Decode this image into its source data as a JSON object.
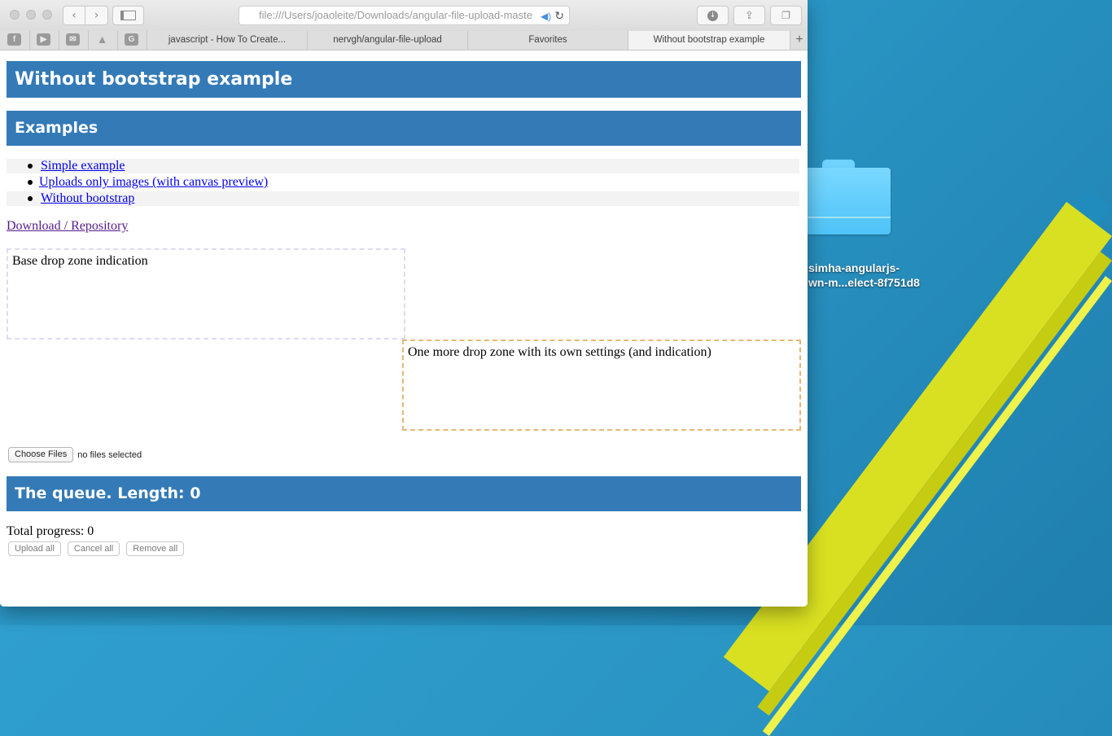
{
  "browser": {
    "address_url": "file:///Users/joaoleite/Downloads/angular-file-upload-maste",
    "favorites": [
      "facebook-icon",
      "youtube-icon",
      "gmail-icon",
      "drive-icon",
      "g-icon"
    ],
    "tabs": [
      {
        "label": "javascript - How To Create..."
      },
      {
        "label": "nervgh/angular-file-upload"
      },
      {
        "label": "Favorites"
      },
      {
        "label": "Without bootstrap example",
        "active": true
      }
    ],
    "new_tab_label": "+"
  },
  "page": {
    "title": "Without bootstrap example",
    "examples_heading": "Examples",
    "examples": [
      {
        "label": "Simple example"
      },
      {
        "label": "Uploads only images (with canvas preview)"
      },
      {
        "label": "Without bootstrap"
      }
    ],
    "download_link": "Download / Repository",
    "dropzone_base": "Base drop zone indication",
    "dropzone_more": "One more drop zone with its own settings (and indication)",
    "file_input": {
      "button_label": "Choose Files",
      "status": "no files selected"
    },
    "queue_heading": "The queue. Length: 0",
    "total_progress": "Total progress: 0",
    "actions": {
      "upload_all": "Upload all",
      "cancel_all": "Cancel all",
      "remove_all": "Remove all"
    }
  },
  "desktop": {
    "folder_label_line1": "simha-angularjs-",
    "folder_label_line2": "wn-m...elect-8f751d8"
  },
  "colors": {
    "banner": "#337ab7",
    "link": "#0000ee",
    "visited_link": "#551a8b",
    "dropzone_base_border": "#dcdcf2",
    "dropzone_more_border": "#e6b77a"
  }
}
